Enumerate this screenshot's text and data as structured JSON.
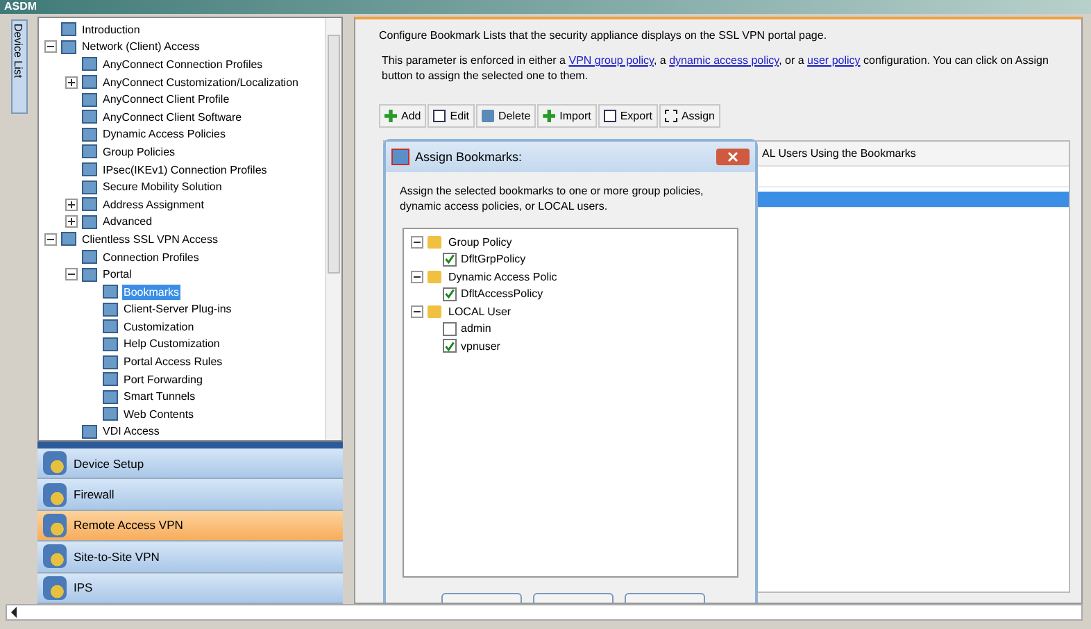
{
  "window": {
    "title": "ASDM"
  },
  "device_list_tab": {
    "label": "Device List"
  },
  "tree": [
    {
      "label": "Introduction",
      "selected": false
    },
    {
      "label": "Network (Client) Access",
      "selected": false,
      "expanded": true,
      "children": [
        {
          "label": "AnyConnect Connection Profiles",
          "selected": false
        },
        {
          "label": "AnyConnect Customization/Localization",
          "selected": false,
          "expanded": false
        },
        {
          "label": "AnyConnect Client Profile",
          "selected": false
        },
        {
          "label": "AnyConnect Client Software",
          "selected": false
        },
        {
          "label": "Dynamic Access Policies",
          "selected": false
        },
        {
          "label": "Group Policies",
          "selected": false
        },
        {
          "label": "IPsec(IKEv1) Connection Profiles",
          "selected": false
        },
        {
          "label": "Secure Mobility Solution",
          "selected": false
        },
        {
          "label": "Address Assignment",
          "selected": false,
          "expanded": false
        },
        {
          "label": "Advanced",
          "selected": false,
          "expanded": false
        }
      ]
    },
    {
      "label": "Clientless SSL VPN Access",
      "selected": false,
      "expanded": true,
      "children": [
        {
          "label": "Connection Profiles",
          "selected": false
        },
        {
          "label": "Portal",
          "selected": false,
          "expanded": true,
          "children": [
            {
              "label": "Bookmarks",
              "selected": true
            },
            {
              "label": "Client-Server Plug-ins",
              "selected": false
            },
            {
              "label": "Customization",
              "selected": false
            },
            {
              "label": "Help Customization",
              "selected": false
            },
            {
              "label": "Portal Access Rules",
              "selected": false
            },
            {
              "label": "Port Forwarding",
              "selected": false
            },
            {
              "label": "Smart Tunnels",
              "selected": false
            },
            {
              "label": "Web Contents",
              "selected": false
            }
          ]
        },
        {
          "label": "VDI Access",
          "selected": false
        }
      ]
    }
  ],
  "nav_buttons": [
    {
      "label": "Device Setup",
      "selected": false
    },
    {
      "label": "Firewall",
      "selected": false
    },
    {
      "label": "Remote Access VPN",
      "selected": true
    },
    {
      "label": "Site-to-Site VPN",
      "selected": false
    },
    {
      "label": "IPS",
      "selected": false
    }
  ],
  "heading": "Configure Bookmark Lists that the security appliance displays on the SSL VPN portal page.",
  "description": [
    {
      "kind": "text",
      "text": "This parameter is enforced in either a "
    },
    {
      "kind": "link",
      "text": "VPN group policy"
    },
    {
      "kind": "text",
      "text": ", a "
    },
    {
      "kind": "link",
      "text": "dynamic access policy"
    },
    {
      "kind": "text",
      "text": ", or a "
    },
    {
      "kind": "link",
      "text": "user policy"
    },
    {
      "kind": "text",
      "text": " configuration. You can click on Assign button to assign the selected one to them."
    }
  ],
  "toolbar": [
    "Add",
    "Edit",
    "Delete",
    "Import",
    "Export",
    "Assign"
  ],
  "table": {
    "column_header": "AL Users Using the Bookmarks",
    "rows": [
      {
        "selected": false
      },
      {
        "selected": true
      }
    ]
  },
  "dialog": {
    "title": "Assign Bookmarks:",
    "message": "Assign the selected bookmarks to one or more group policies, dynamic access policies, or LOCAL users.",
    "groups": [
      {
        "label": "Group Policy",
        "expanded": true,
        "children": [
          {
            "label": "DfltGrpPolicy",
            "checked": true
          }
        ]
      },
      {
        "label": "Dynamic Access Polic",
        "expanded": true,
        "children": [
          {
            "label": "DfltAccessPolicy",
            "checked": true
          }
        ]
      },
      {
        "label": "LOCAL User",
        "expanded": true,
        "children": [
          {
            "label": "admin",
            "checked": false
          },
          {
            "label": "vpnuser",
            "checked": true
          }
        ]
      }
    ]
  }
}
